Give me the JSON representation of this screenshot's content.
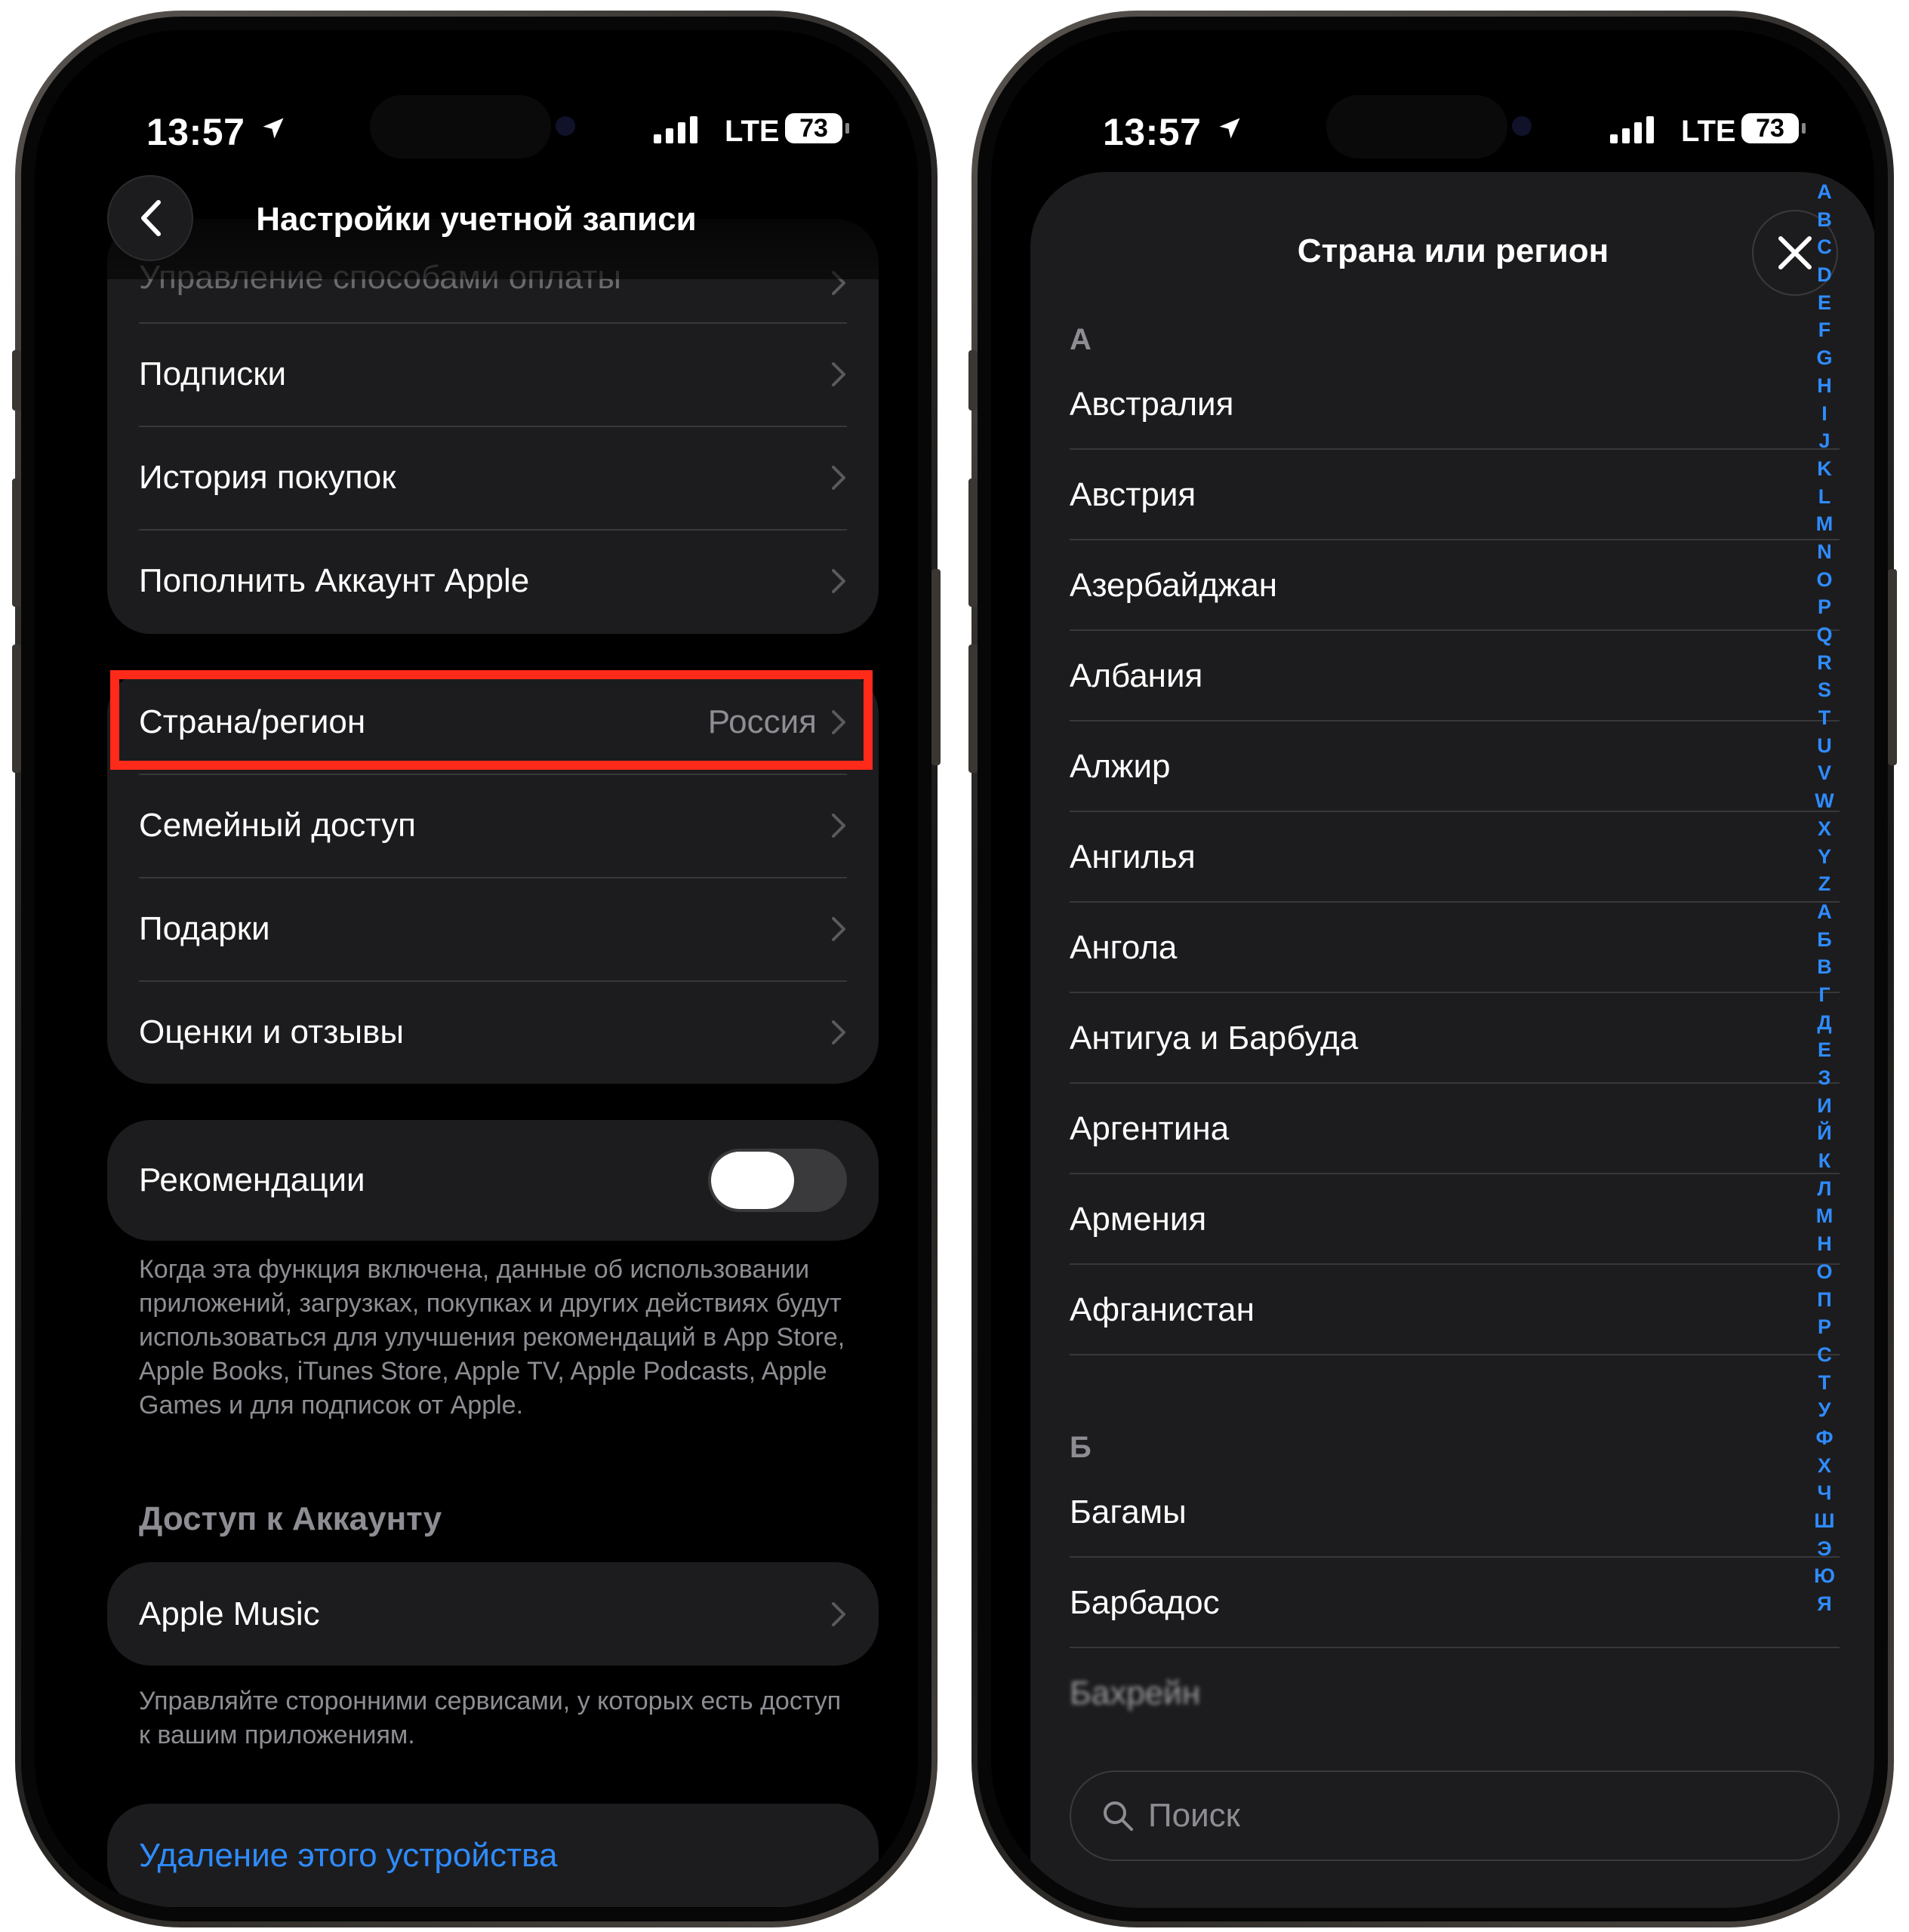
{
  "status_bar": {
    "time": "13:57",
    "network": "LTE",
    "battery": "73"
  },
  "left": {
    "nav": {
      "title": "Настройки учетной записи"
    },
    "group1": [
      {
        "label": "Управление способами оплаты"
      },
      {
        "label": "Подписки"
      },
      {
        "label": "История покупок"
      },
      {
        "label": "Пополнить Аккаунт Apple"
      }
    ],
    "group2": [
      {
        "label": "Страна/регион",
        "value": "Россия"
      },
      {
        "label": "Семейный доступ"
      },
      {
        "label": "Подарки"
      },
      {
        "label": "Оценки и отзывы"
      }
    ],
    "recommendations": {
      "label": "Рекомендации",
      "enabled": true,
      "footnote": "Когда эта функция включена, данные об использовании приложений, загрузках, покупках и других действиях будут использоваться для улучшения рекомендаций в App Store, Apple Books, iTunes Store, Apple TV, Apple Podcasts, Apple Games и для подписок от Apple."
    },
    "account_access": {
      "header": "Доступ к Аккаунту",
      "item": "Apple Music",
      "footnote": "Управляйте сторонними сервисами, у которых есть доступ к вашим приложениям."
    },
    "remove_device": "Удаление этого устройства"
  },
  "right": {
    "sheet_title": "Страна или регион",
    "sections": [
      {
        "letter": "А",
        "countries": [
          "Австралия",
          "Австрия",
          "Азербайджан",
          "Албания",
          "Алжир",
          "Ангилья",
          "Ангола",
          "Антигуа и Барбуда",
          "Аргентина",
          "Армения",
          "Афганистан"
        ]
      },
      {
        "letter": "Б",
        "countries": [
          "Багамы",
          "Барбадос",
          "Бахрейн"
        ]
      }
    ],
    "index_letters": [
      "A",
      "B",
      "C",
      "D",
      "E",
      "F",
      "G",
      "H",
      "I",
      "J",
      "K",
      "L",
      "M",
      "N",
      "O",
      "P",
      "Q",
      "R",
      "S",
      "T",
      "U",
      "V",
      "W",
      "X",
      "Y",
      "Z",
      "А",
      "Б",
      "В",
      "Г",
      "Д",
      "Е",
      "З",
      "И",
      "Й",
      "К",
      "Л",
      "М",
      "Н",
      "О",
      "П",
      "Р",
      "С",
      "Т",
      "У",
      "Ф",
      "Х",
      "Ч",
      "Ш",
      "Э",
      "Ю",
      "Я"
    ],
    "search_placeholder": "Поиск"
  },
  "colors": {
    "accent": "#2f8cff",
    "highlight_box": "#ff2a1a",
    "cell_bg": "#1c1c1e",
    "secondary_text": "#8d8d93"
  }
}
